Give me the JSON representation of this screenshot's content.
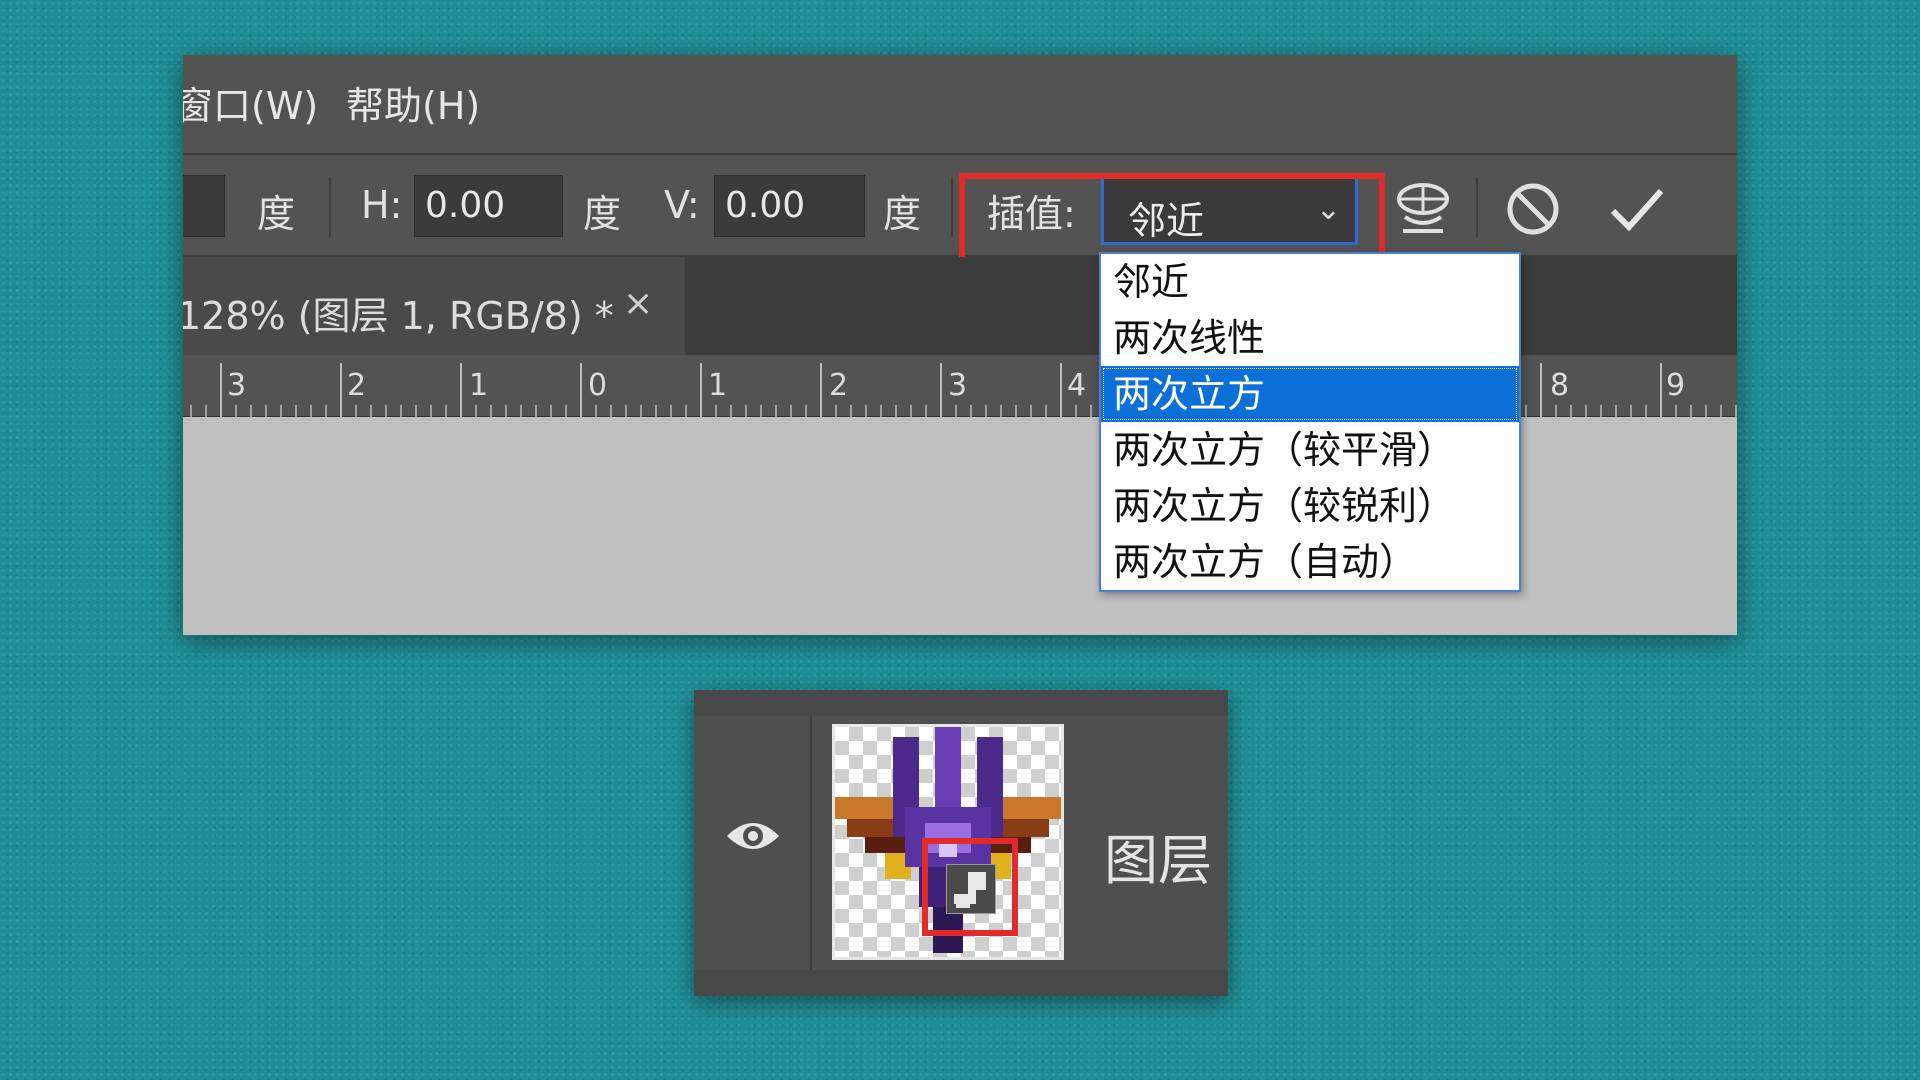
{
  "menubar": {
    "window_label": "窗口(W)",
    "help_label": "帮助(H)"
  },
  "options_bar": {
    "angle_unit": "度",
    "h_label": "H:",
    "h_value": "0.00",
    "h_unit": "度",
    "v_label": "V:",
    "v_value": "0.00",
    "v_unit": "度",
    "interpolation_label": "插值:",
    "interpolation_value": "邻近",
    "icons": [
      "warp-toggle-icon",
      "cancel-icon",
      "commit-checkmark-icon"
    ]
  },
  "document_tab": {
    "title": "128% (图层 1, RGB/8) *",
    "close_glyph": "×"
  },
  "ruler": {
    "labels": [
      "3",
      "2",
      "1",
      "0",
      "1",
      "2",
      "3",
      "4",
      "8",
      "9"
    ]
  },
  "interpolation_dropdown": {
    "options": [
      "邻近",
      "两次线性",
      "两次立方",
      "两次立方（较平滑）",
      "两次立方（较锐利）",
      "两次立方（自动）"
    ],
    "selected_index": 2
  },
  "layers_panel": {
    "layer_name": "图层",
    "thumbnail_badge_icon": "smart-object-icon"
  },
  "colors": {
    "background": "#1f8f97",
    "panel": "#535353",
    "highlight_red": "#e12b2b",
    "selection_blue": "#0a6fd6"
  }
}
